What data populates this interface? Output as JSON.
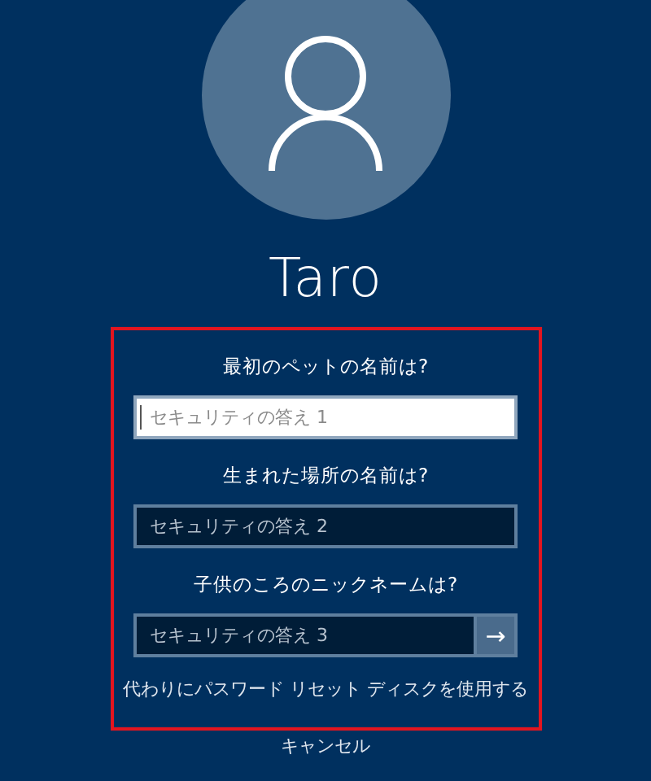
{
  "user": {
    "name": "Taro"
  },
  "security_questions": [
    {
      "question": "最初のペットの名前は?",
      "placeholder": "セキュリティの答え 1",
      "focused": true
    },
    {
      "question": "生まれた場所の名前は?",
      "placeholder": "セキュリティの答え 2",
      "focused": false
    },
    {
      "question": "子供のころのニックネームは?",
      "placeholder": "セキュリティの答え 3",
      "focused": false,
      "submit": "→"
    }
  ],
  "reset_disk_link": "代わりにパスワード リセット ディスクを使用する",
  "cancel_link": "キャンセル"
}
